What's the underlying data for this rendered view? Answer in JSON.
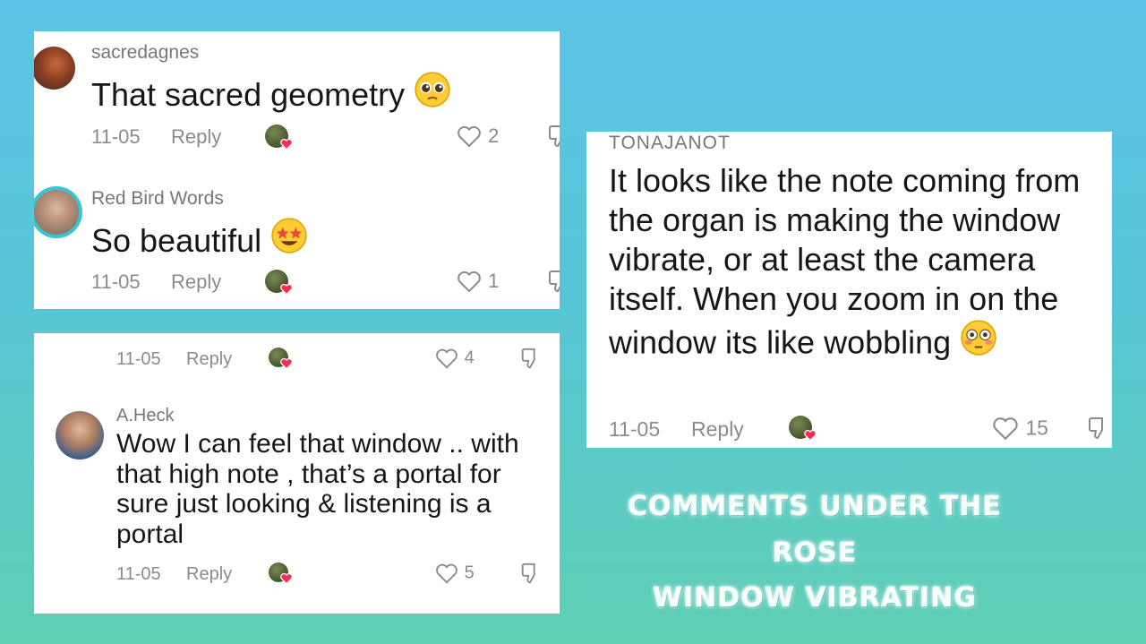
{
  "colors": {
    "background_top": "#5ec3e6",
    "background_bottom": "#5fcfb3",
    "panel": "#ffffff",
    "username": "#777777",
    "body_text": "#161616",
    "meta_text": "#8b8b8b",
    "caption_text": "#f6fff8"
  },
  "panels": [
    {
      "comments": [
        {
          "username": "sacredagnes",
          "text": "That sacred geometry",
          "emoji": "pleading-face",
          "date": "11-05",
          "reply_label": "Reply",
          "like_count": "2"
        },
        {
          "username": "Red Bird Words",
          "text": "So beautiful",
          "emoji": "star-struck-face",
          "date": "11-05",
          "reply_label": "Reply",
          "like_count": "1"
        }
      ]
    },
    {
      "partial_comment": {
        "date": "11-05",
        "reply_label": "Reply",
        "like_count": "4"
      },
      "comments": [
        {
          "username": "A.Heck",
          "text": "Wow I can feel that window .. with that high note , that’s a portal for sure just looking & listening is a portal",
          "date": "11-05",
          "reply_label": "Reply",
          "like_count": "5"
        }
      ]
    },
    {
      "comments": [
        {
          "username": "TONAJANOT",
          "text": "It looks like the note coming from the organ is making the window vibrate, or at least the camera itself. When you zoom in on the window its like wobbling",
          "emoji": "flushed-face",
          "date": "11-05",
          "reply_label": "Reply",
          "like_count": "15"
        }
      ]
    }
  ],
  "caption": {
    "line1": "COMMENTS UNDER THE",
    "line2": "ROSE",
    "line3": "WINDOW VIBRATING"
  }
}
